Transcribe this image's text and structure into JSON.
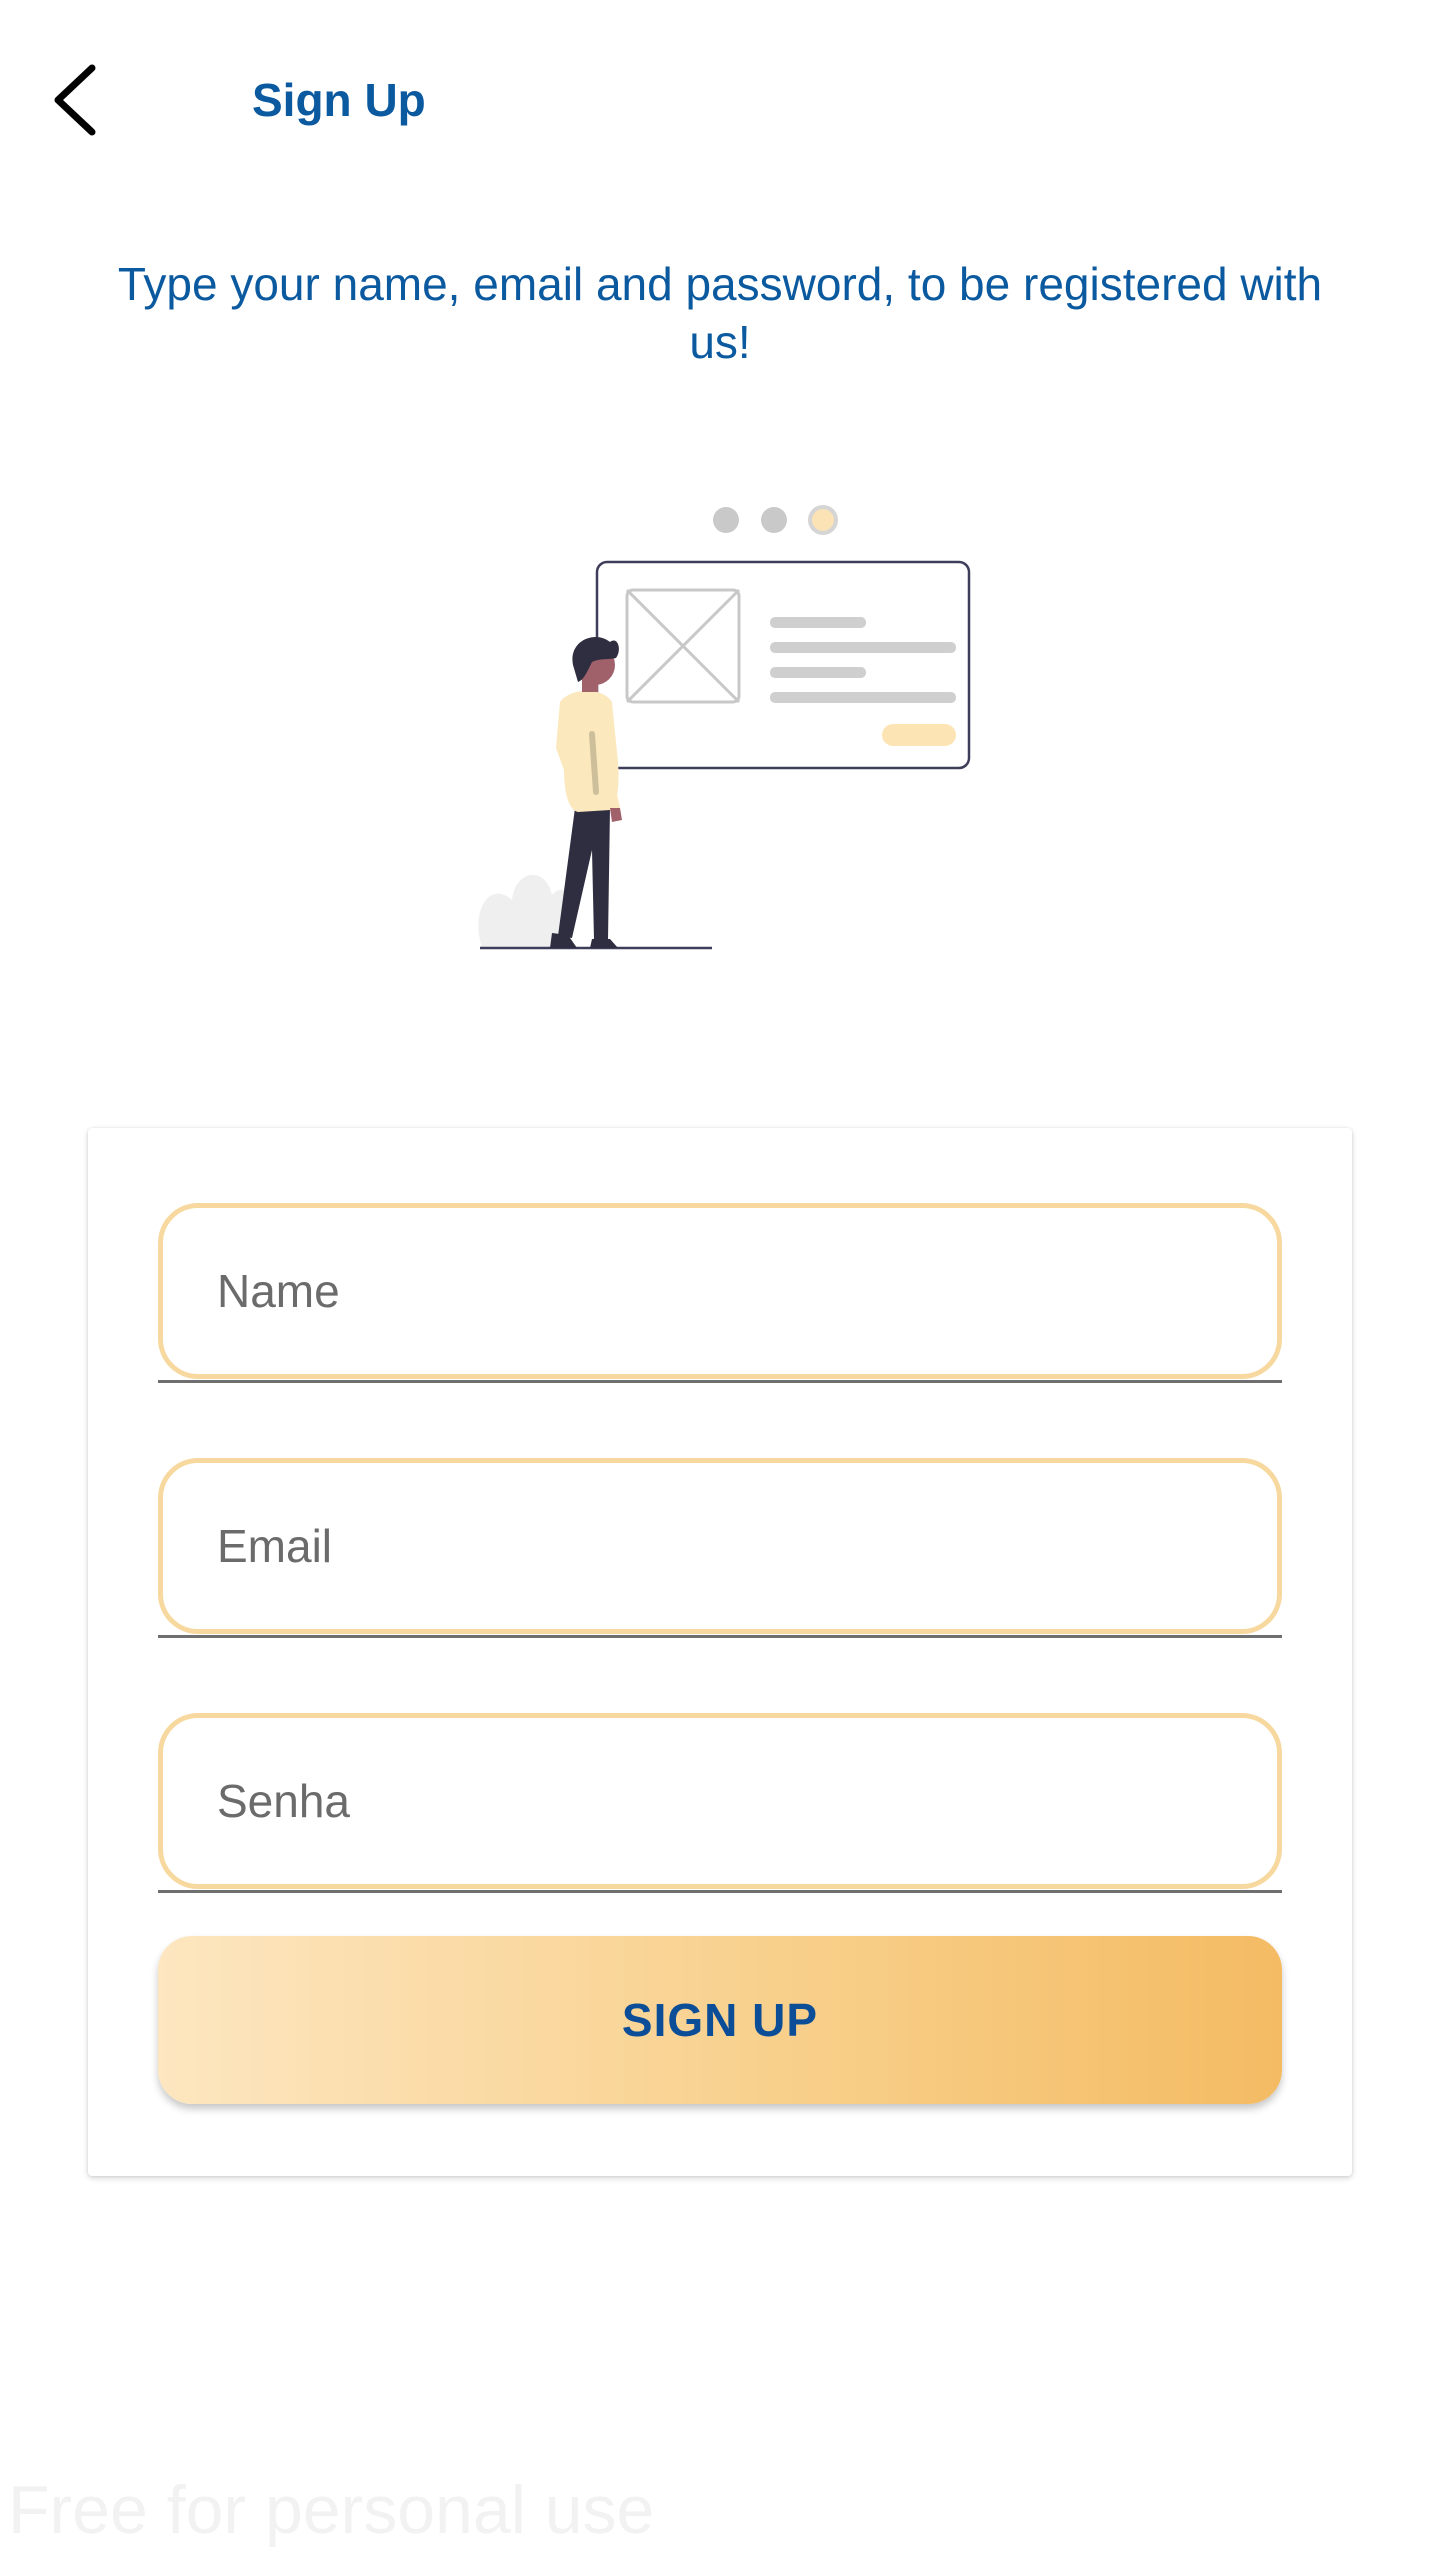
{
  "header": {
    "back_icon": "chevron-left-icon",
    "title": "Sign Up"
  },
  "intro": {
    "text": "Type your name, email and password, to be registered with us!"
  },
  "form": {
    "name_placeholder": "Name",
    "email_placeholder": "Email",
    "password_placeholder": "Senha",
    "submit_label": "SIGN UP"
  },
  "watermark": "Free for personal use",
  "colors": {
    "primary_text": "#0b5aa0",
    "accent_yellow": "#f4bb63",
    "field_border": "#f7d9a0",
    "button_text": "#0b4d96"
  }
}
